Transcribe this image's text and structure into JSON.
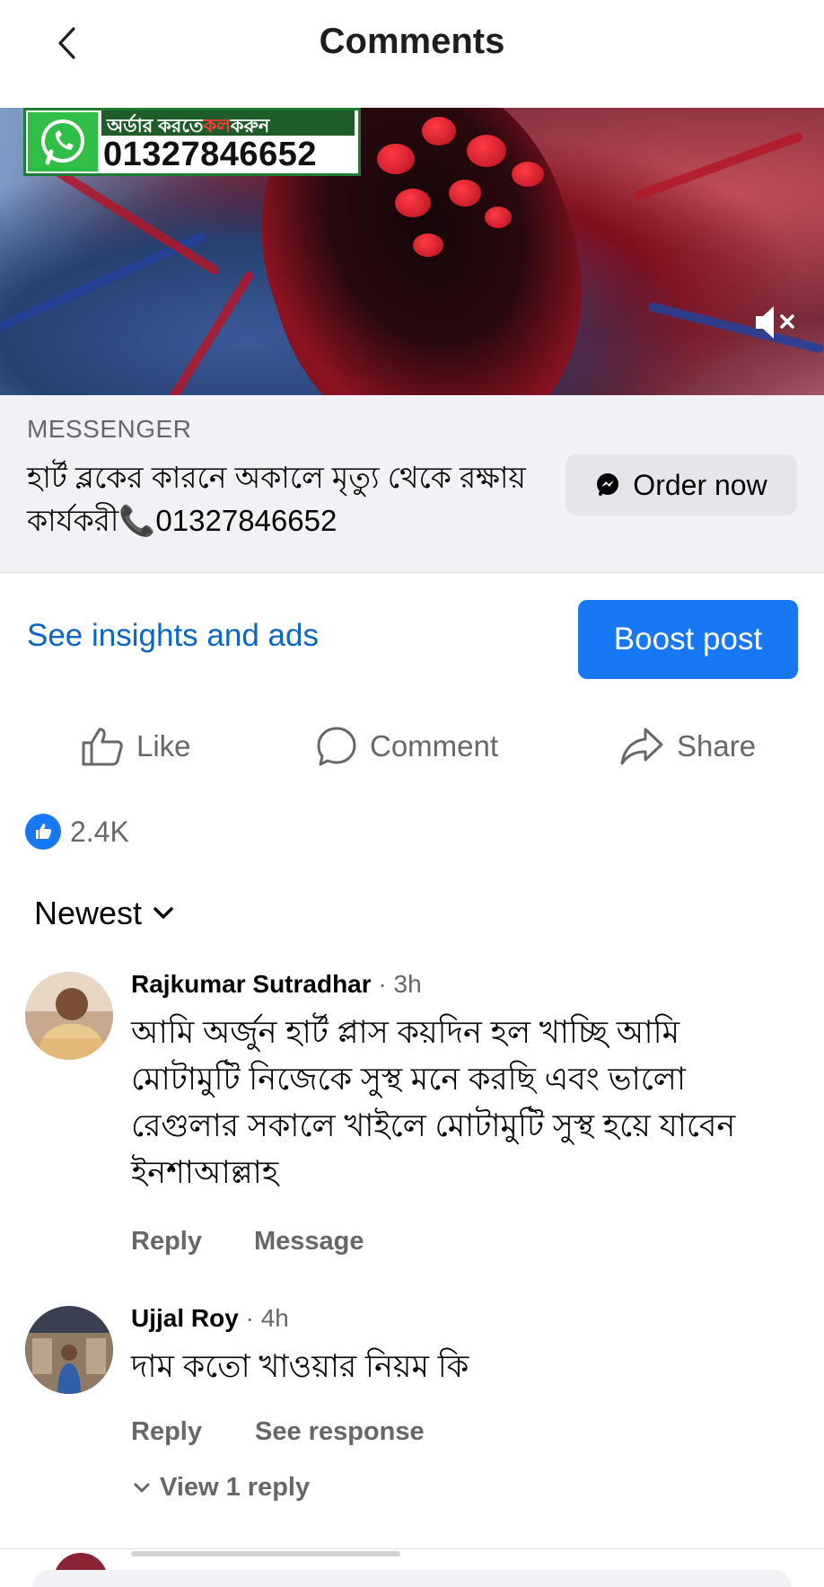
{
  "header": {
    "title": "Comments"
  },
  "media": {
    "promo_top": "অর্ডার করতে",
    "promo_top_red": "কল",
    "promo_top_end": "করুন",
    "promo_phone": "01327846652",
    "mute_icon": "muted-speaker-icon"
  },
  "ad": {
    "source": "MESSENGER",
    "text": "হার্ট ব্লকের কারনে অকালে মৃত্যু থেকে রক্ষায় কার্যকরী📞01327846652",
    "order_label": "Order now",
    "order_icon": "messenger-icon"
  },
  "insights_link": "See insights and ads",
  "boost_label": "Boost post",
  "actions": [
    {
      "label": "Like",
      "icon": "thumbs-up-icon"
    },
    {
      "label": "Comment",
      "icon": "comment-bubble-icon"
    },
    {
      "label": "Share",
      "icon": "share-arrow-icon"
    }
  ],
  "reactions": {
    "count": "2.4K",
    "icon": "like-badge-icon"
  },
  "sort": {
    "label": "Newest",
    "icon": "chevron-down-icon"
  },
  "comments": [
    {
      "name": "Rajkumar Sutradhar",
      "time": "3h",
      "text": "আমি অর্জুন হার্ট প্লাস কয়দিন হল খাচ্ছি আমি মোটামুটি নিজেকে সুস্থ মনে করছি এবং ভালো রেগুলার সকালে খাইলে মোটামুটি সুস্থ হয়ে যাবেন ইনশাআল্লাহ",
      "actions": [
        "Reply",
        "Message"
      ]
    },
    {
      "name": "Ujjal Roy",
      "time": "4h",
      "text": "দাম কতো খাওয়ার নিয়ম কি",
      "actions": [
        "Reply",
        "See response"
      ],
      "view_replies": "View 1 reply"
    }
  ],
  "colors": {
    "accent": "#1877f2",
    "link": "#0a66c2",
    "secondary_text": "#65676b",
    "ad_card_bg": "#f0f2f5"
  }
}
